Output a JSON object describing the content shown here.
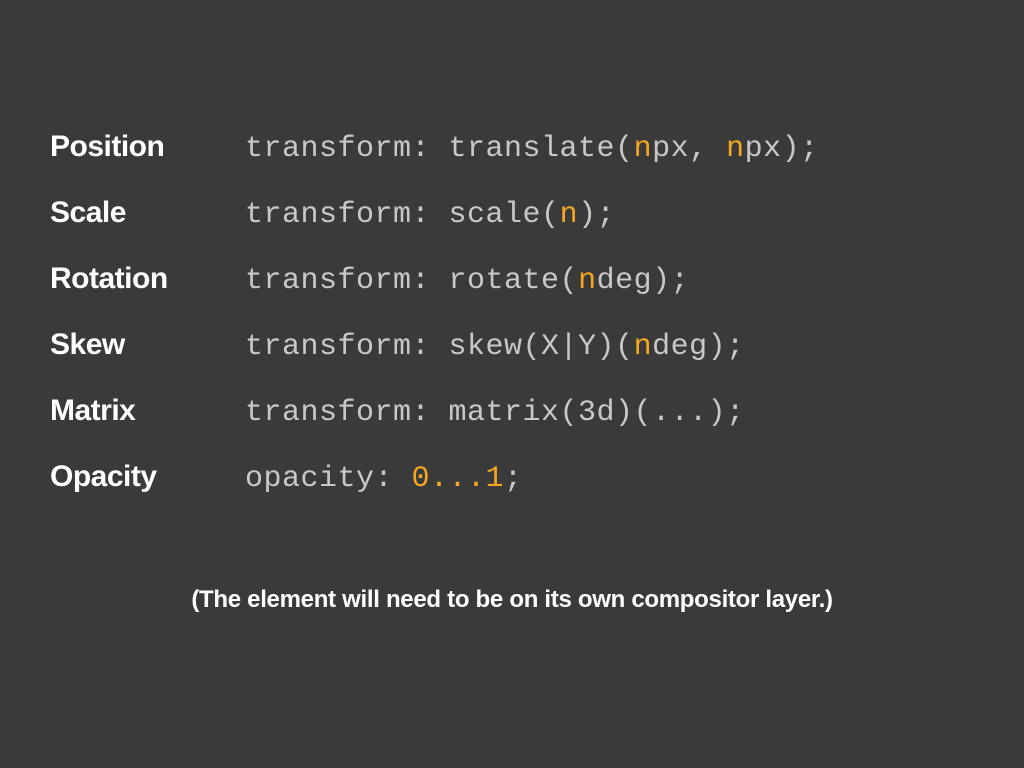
{
  "rows": [
    {
      "label": "Position",
      "segments": [
        {
          "text": "transform: translate(",
          "accent": false
        },
        {
          "text": "n",
          "accent": true
        },
        {
          "text": "px, ",
          "accent": false
        },
        {
          "text": "n",
          "accent": true
        },
        {
          "text": "px);",
          "accent": false
        }
      ]
    },
    {
      "label": "Scale",
      "segments": [
        {
          "text": "transform: scale(",
          "accent": false
        },
        {
          "text": "n",
          "accent": true
        },
        {
          "text": ");",
          "accent": false
        }
      ]
    },
    {
      "label": "Rotation",
      "segments": [
        {
          "text": "transform: rotate(",
          "accent": false
        },
        {
          "text": "n",
          "accent": true
        },
        {
          "text": "deg);",
          "accent": false
        }
      ]
    },
    {
      "label": "Skew",
      "segments": [
        {
          "text": "transform: skew(X|Y)(",
          "accent": false
        },
        {
          "text": "n",
          "accent": true
        },
        {
          "text": "deg);",
          "accent": false
        }
      ]
    },
    {
      "label": "Matrix",
      "segments": [
        {
          "text": "transform: matrix(3d)(...);",
          "accent": false
        }
      ]
    },
    {
      "label": "Opacity",
      "segments": [
        {
          "text": "opacity: ",
          "accent": false
        },
        {
          "text": "0...1",
          "accent": true
        },
        {
          "text": ";",
          "accent": false
        }
      ]
    }
  ],
  "footnote": "(The element will need to be on its own compositor layer.)",
  "colors": {
    "background": "#3a3a3a",
    "code": "#c8c8c8",
    "accent": "#f5a623",
    "label": "#ffffff"
  }
}
